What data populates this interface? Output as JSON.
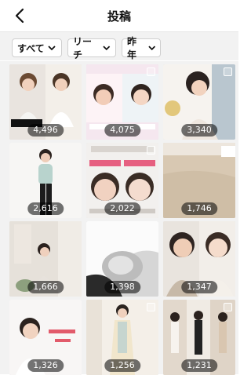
{
  "header": {
    "title": "投稿"
  },
  "filters": [
    {
      "label": "すべて"
    },
    {
      "label": "リーチ"
    },
    {
      "label": "昨年"
    }
  ],
  "posts": [
    {
      "count": "4,496"
    },
    {
      "count": "4,075"
    },
    {
      "count": "3,340"
    },
    {
      "count": "2,616"
    },
    {
      "count": "2,022"
    },
    {
      "count": "1,746"
    },
    {
      "count": "1,666"
    },
    {
      "count": "1,398"
    },
    {
      "count": "1,347"
    },
    {
      "count": "1,326"
    },
    {
      "count": "1,256"
    },
    {
      "count": "1,231"
    }
  ],
  "icons": {
    "back": "chevron-left-icon",
    "dropdown": "chevron-down-icon",
    "carousel": "carousel-icon"
  }
}
